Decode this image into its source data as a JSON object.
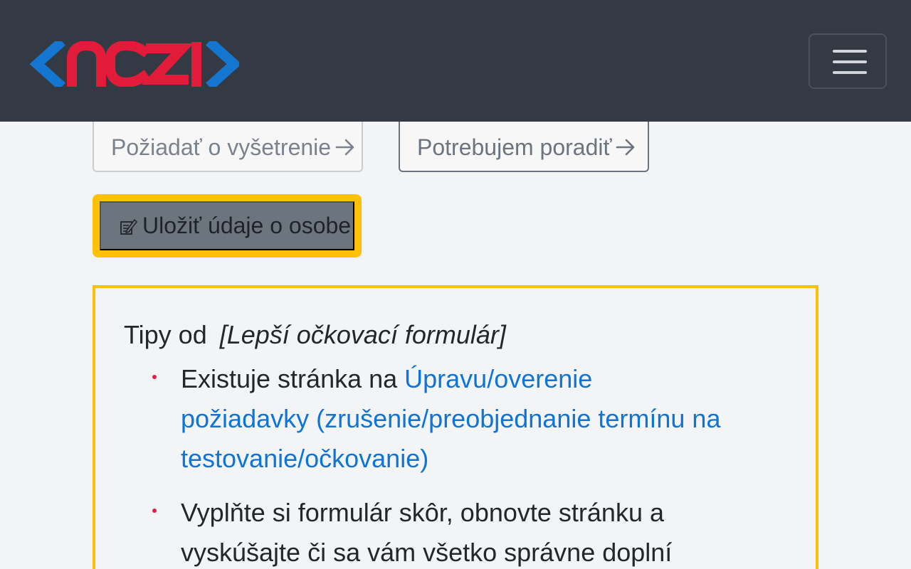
{
  "navbar": {
    "brand": "nczi",
    "menu_icon": "hamburger-icon"
  },
  "actions": {
    "request_exam_label": "Požiadať o vyšetrenie",
    "need_advice_label": "Potrebujem poradiť",
    "arrow_icon": "arrow-right-icon",
    "save_person_label": "Uložiť údaje o osobe",
    "save_icon": "edit-document-icon"
  },
  "tips": {
    "prefix": "Tipy od",
    "source": "[Lepší očkovací formulár]",
    "items": [
      {
        "text": "Existuje stránka na ",
        "link": "Úpravu/overenie požiadavky (zrušenie/preobjednanie termínu na testovanie/očkovanie)"
      },
      {
        "text": "Vyplňte si formulár skôr, obnovte stránku a vyskúšajte či sa vám všetko správne doplní"
      }
    ]
  },
  "colors": {
    "navbar": "#343a43",
    "page_background": "#f3f4f6",
    "highlight": "#ffc107",
    "save_button": "#6c757d",
    "link": "#0d74d8",
    "bullet": "#e11d48",
    "logo_blue": "#1576d1",
    "logo_red": "#e31b3b"
  }
}
